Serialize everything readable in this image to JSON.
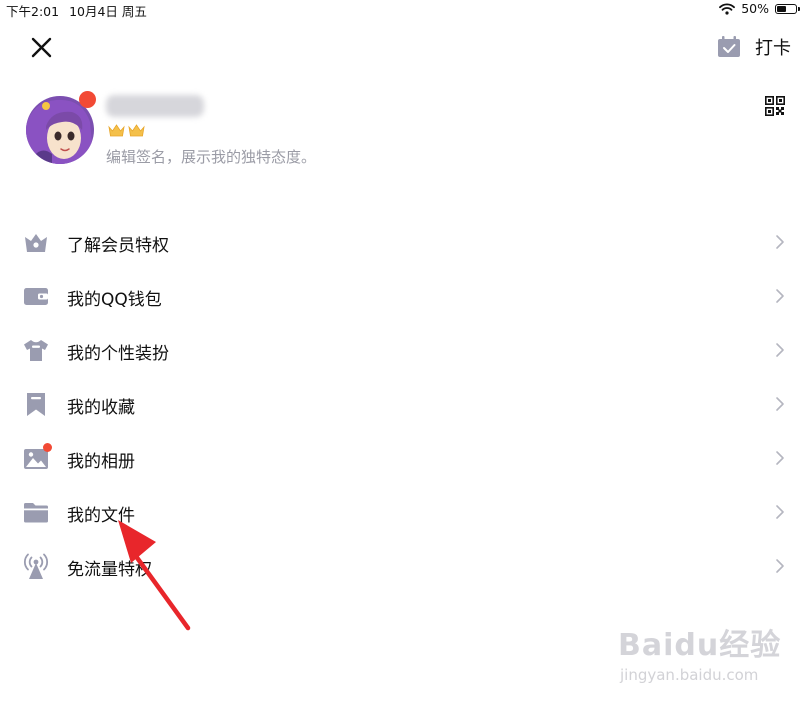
{
  "status_bar": {
    "time": "下午2:01",
    "date": "10月4日 周五",
    "battery_text": "50%",
    "battery_level": 0.5
  },
  "header": {
    "checkin_label": "打卡"
  },
  "profile": {
    "signature": "编辑签名，展示我的独特态度。"
  },
  "menu": {
    "items": [
      {
        "label": "了解会员特权",
        "icon": "vip-crown-icon"
      },
      {
        "label": "我的QQ钱包",
        "icon": "wallet-icon"
      },
      {
        "label": "我的个性装扮",
        "icon": "tshirt-icon"
      },
      {
        "label": "我的收藏",
        "icon": "bookmark-icon"
      },
      {
        "label": "我的相册",
        "icon": "photo-album-icon"
      },
      {
        "label": "我的文件",
        "icon": "folder-icon"
      },
      {
        "label": "免流量特权",
        "icon": "signal-tower-icon"
      }
    ]
  },
  "watermark": {
    "brand": "Baidu经验",
    "url": "jingyan.baidu.com"
  },
  "colors": {
    "icon_gray": "#9a9cb0",
    "badge_red": "#f24a35",
    "arrow_red": "#e8262b",
    "signature_gray": "#9b9ca6"
  }
}
